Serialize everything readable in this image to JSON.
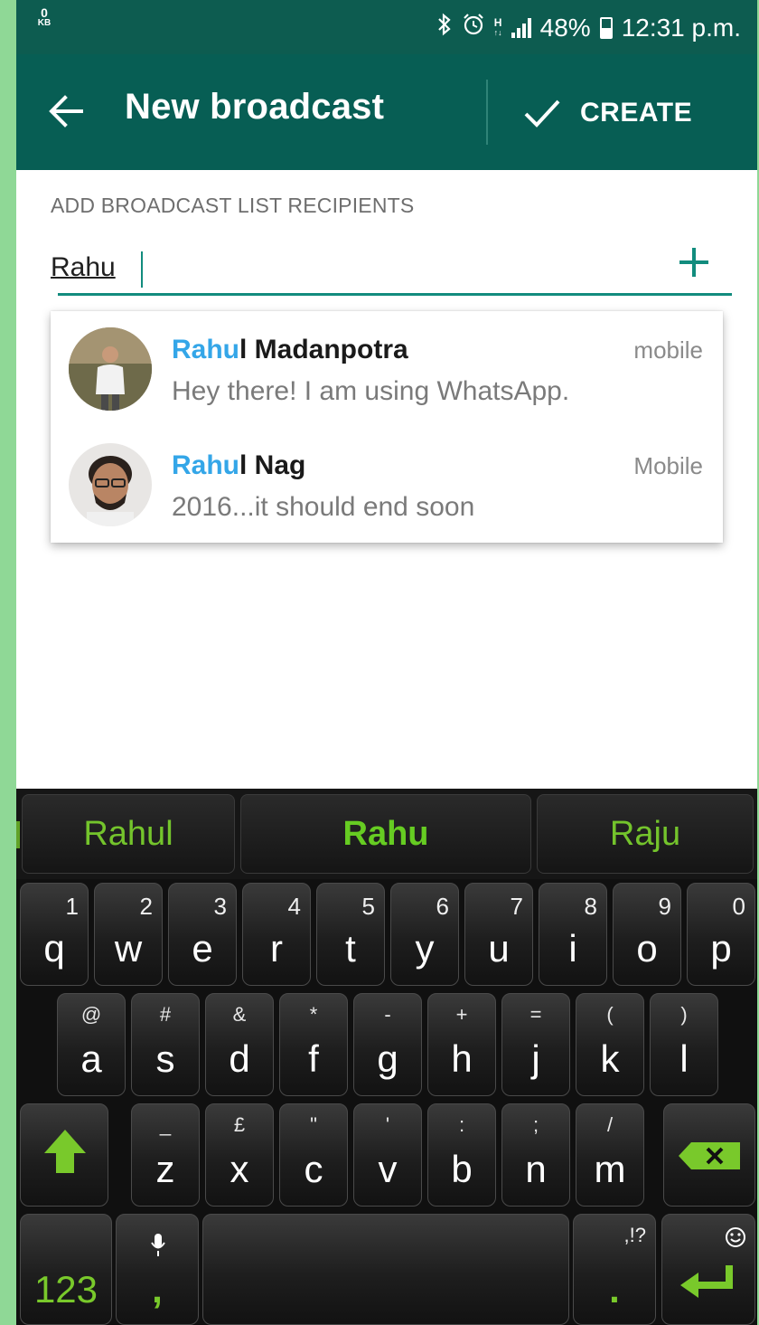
{
  "status_bar": {
    "data_speed": "0",
    "data_unit": "KB",
    "network_type": "H",
    "battery_percent": "48%",
    "time": "12:31 p.m."
  },
  "toolbar": {
    "back_icon": "arrow-left-icon",
    "title": "New broadcast",
    "create_icon": "check-icon",
    "create_label": "CREATE"
  },
  "recipients": {
    "section_label": "ADD BROADCAST LIST RECIPIENTS",
    "search_value": "Rahu",
    "add_icon": "plus-icon"
  },
  "suggestions": [
    {
      "name_highlight": "Rahu",
      "name_rest": "l Madanpotra",
      "status": "Hey there! I am using WhatsApp.",
      "type": "mobile"
    },
    {
      "name_highlight": "Rahu",
      "name_rest": "l Nag",
      "status": "2016...it should end soon",
      "type": "Mobile"
    }
  ],
  "keyboard": {
    "word_suggestions": [
      "Rahul",
      "Rahu",
      "Raju"
    ],
    "row1": [
      {
        "main": "q",
        "alt": "1"
      },
      {
        "main": "w",
        "alt": "2"
      },
      {
        "main": "e",
        "alt": "3"
      },
      {
        "main": "r",
        "alt": "4"
      },
      {
        "main": "t",
        "alt": "5"
      },
      {
        "main": "y",
        "alt": "6"
      },
      {
        "main": "u",
        "alt": "7"
      },
      {
        "main": "i",
        "alt": "8"
      },
      {
        "main": "o",
        "alt": "9"
      },
      {
        "main": "p",
        "alt": "0"
      }
    ],
    "row2": [
      {
        "main": "a",
        "alt": "@"
      },
      {
        "main": "s",
        "alt": "#"
      },
      {
        "main": "d",
        "alt": "&"
      },
      {
        "main": "f",
        "alt": "*"
      },
      {
        "main": "g",
        "alt": "-"
      },
      {
        "main": "h",
        "alt": "+"
      },
      {
        "main": "j",
        "alt": "="
      },
      {
        "main": "k",
        "alt": "("
      },
      {
        "main": "l",
        "alt": ")"
      }
    ],
    "row3": [
      {
        "main": "z",
        "alt": "_"
      },
      {
        "main": "x",
        "alt": "£"
      },
      {
        "main": "c",
        "alt": "\""
      },
      {
        "main": "v",
        "alt": "'"
      },
      {
        "main": "b",
        "alt": ":"
      },
      {
        "main": "n",
        "alt": ";"
      },
      {
        "main": "m",
        "alt": "/"
      }
    ],
    "numbers_key": "123",
    "comma_key": ",",
    "period_key": ".",
    "punct_alt": ",!?",
    "shift_icon": "shift-arrow-icon",
    "backspace_icon": "backspace-icon",
    "mic_icon": "microphone-icon",
    "emoji_icon": "smiley-icon",
    "enter_icon": "enter-icon",
    "accent_color": "#79c92b"
  },
  "colors": {
    "toolbar": "#075e54",
    "status_bar": "#0d5c50",
    "teal_accent": "#128c7e",
    "highlight_blue": "#34a6e8"
  }
}
